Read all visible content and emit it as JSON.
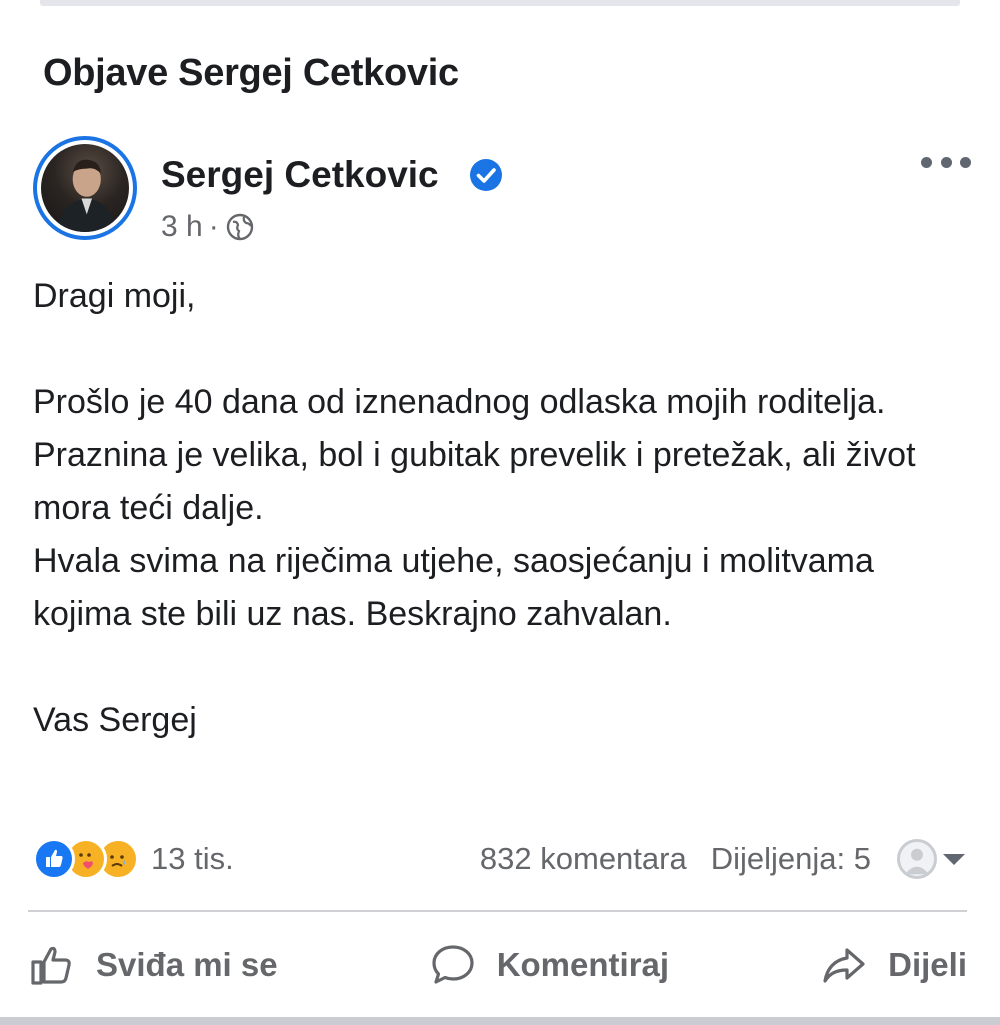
{
  "section": {
    "title": "Objave Sergej Cetkovic"
  },
  "post": {
    "author": "Sergej Cetkovic",
    "time": "3 h",
    "separator": "·",
    "audience_icon": "globe-icon",
    "verified_icon": "verified-badge-icon",
    "more_icon": "more-horizontal-icon",
    "body": {
      "greeting": "Dragi moji,",
      "paragraph1": "Prošlo je 40 dana od iznenadnog odlaska mojih roditelja. Praznina je velika, bol i gubitak prevelik i pretežak, ali život mora teći dalje.",
      "paragraph2": "Hvala svima na riječima utjehe, saosjećanju i molitvama kojima ste bili uz nas. Beskrajno zahvalan.",
      "signoff": "Vas Sergej"
    }
  },
  "stats": {
    "reaction_icons": [
      "like-icon",
      "care-icon",
      "sad-icon"
    ],
    "reactions": "13 tis.",
    "comments": "832 komentara",
    "shares": "Dijeljenja: 5"
  },
  "actions": {
    "like": "Sviđa mi se",
    "comment": "Komentiraj",
    "share": "Dijeli"
  },
  "colors": {
    "accent": "#1b74e4",
    "text": "#1c1e21",
    "secondary": "#65676b",
    "reaction_yellow": "#f7b125"
  }
}
